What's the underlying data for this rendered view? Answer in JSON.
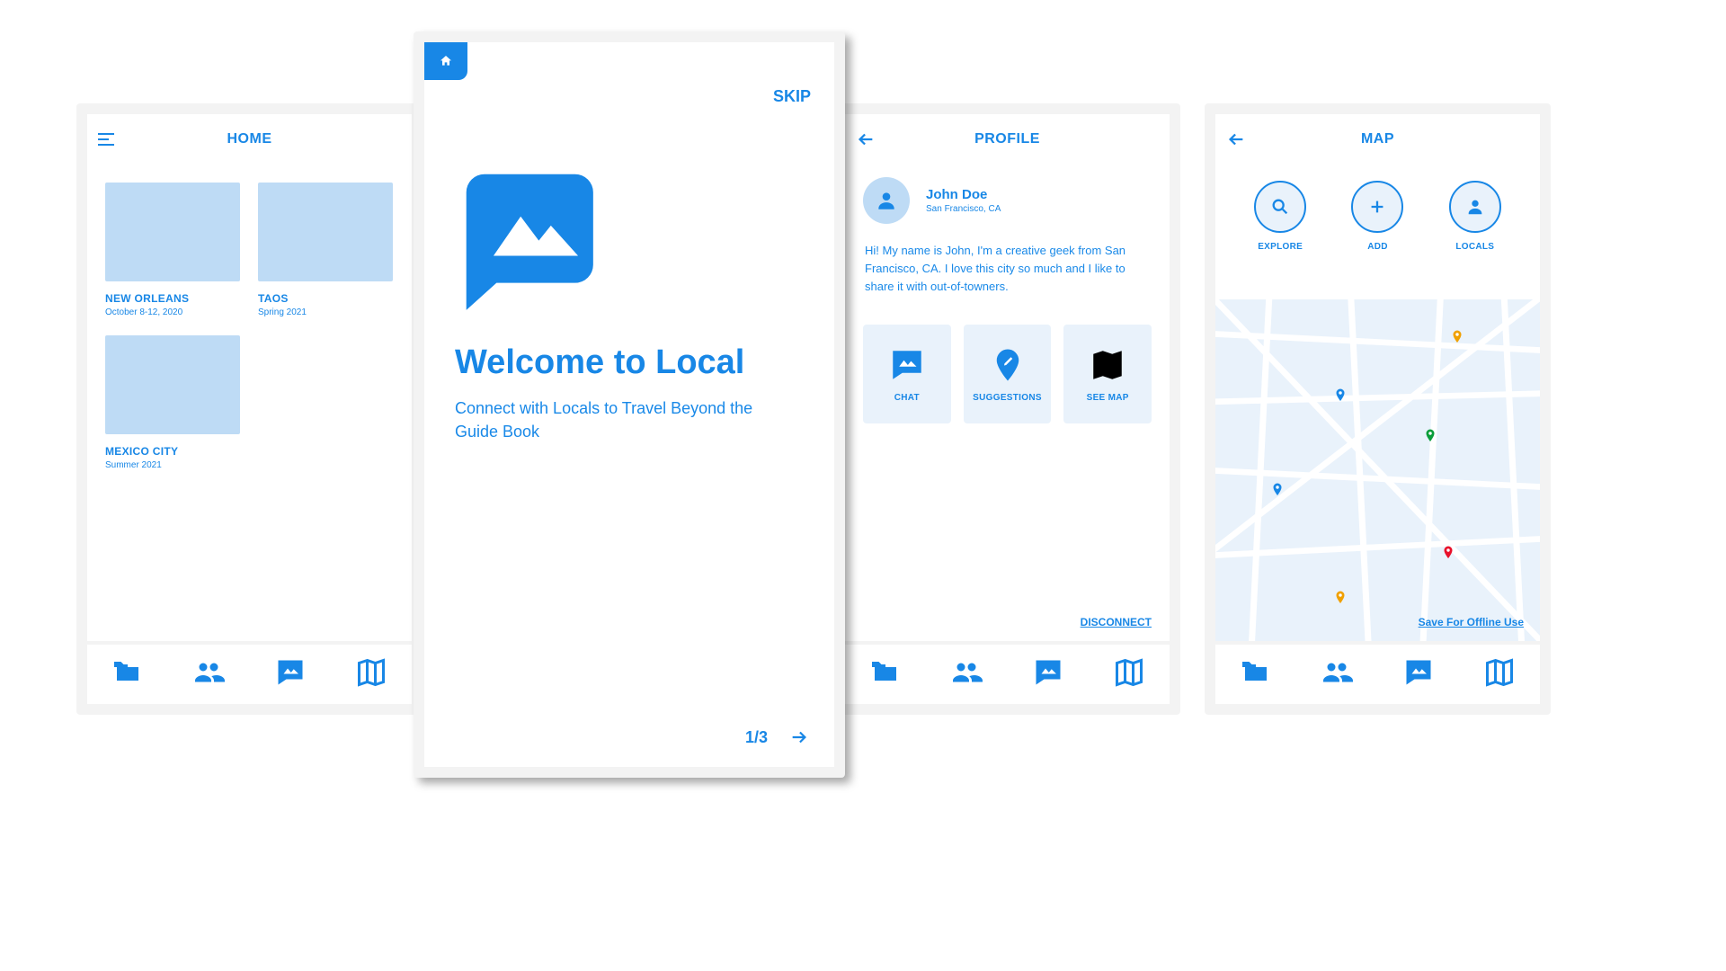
{
  "home": {
    "title": "HOME",
    "cards": [
      {
        "title": "NEW ORLEANS",
        "sub": "October 8-12, 2020"
      },
      {
        "title": "TAOS",
        "sub": "Spring 2021"
      },
      {
        "title": "MEXICO CITY",
        "sub": "Summer 2021"
      }
    ]
  },
  "onboarding": {
    "skip": "SKIP",
    "title": "Welcome to Local",
    "subtitle": "Connect with Locals to Travel Beyond the Guide Book",
    "page": "1/3"
  },
  "profile": {
    "title": "PROFILE",
    "name": "John Doe",
    "location": "San Francisco, CA",
    "bio": "Hi! My name is John, I'm a creative geek from San Francisco, CA. I love this city so much and I like to share it with out-of-towners.",
    "actions": {
      "chat": "CHAT",
      "suggestions": "SUGGESTIONS",
      "map": "SEE MAP"
    },
    "disconnect": "DISCONNECT"
  },
  "map": {
    "title": "MAP",
    "actions": {
      "explore": "EXPLORE",
      "add": "ADD",
      "locals": "LOCALS"
    },
    "save": "Save For Offline Use"
  }
}
